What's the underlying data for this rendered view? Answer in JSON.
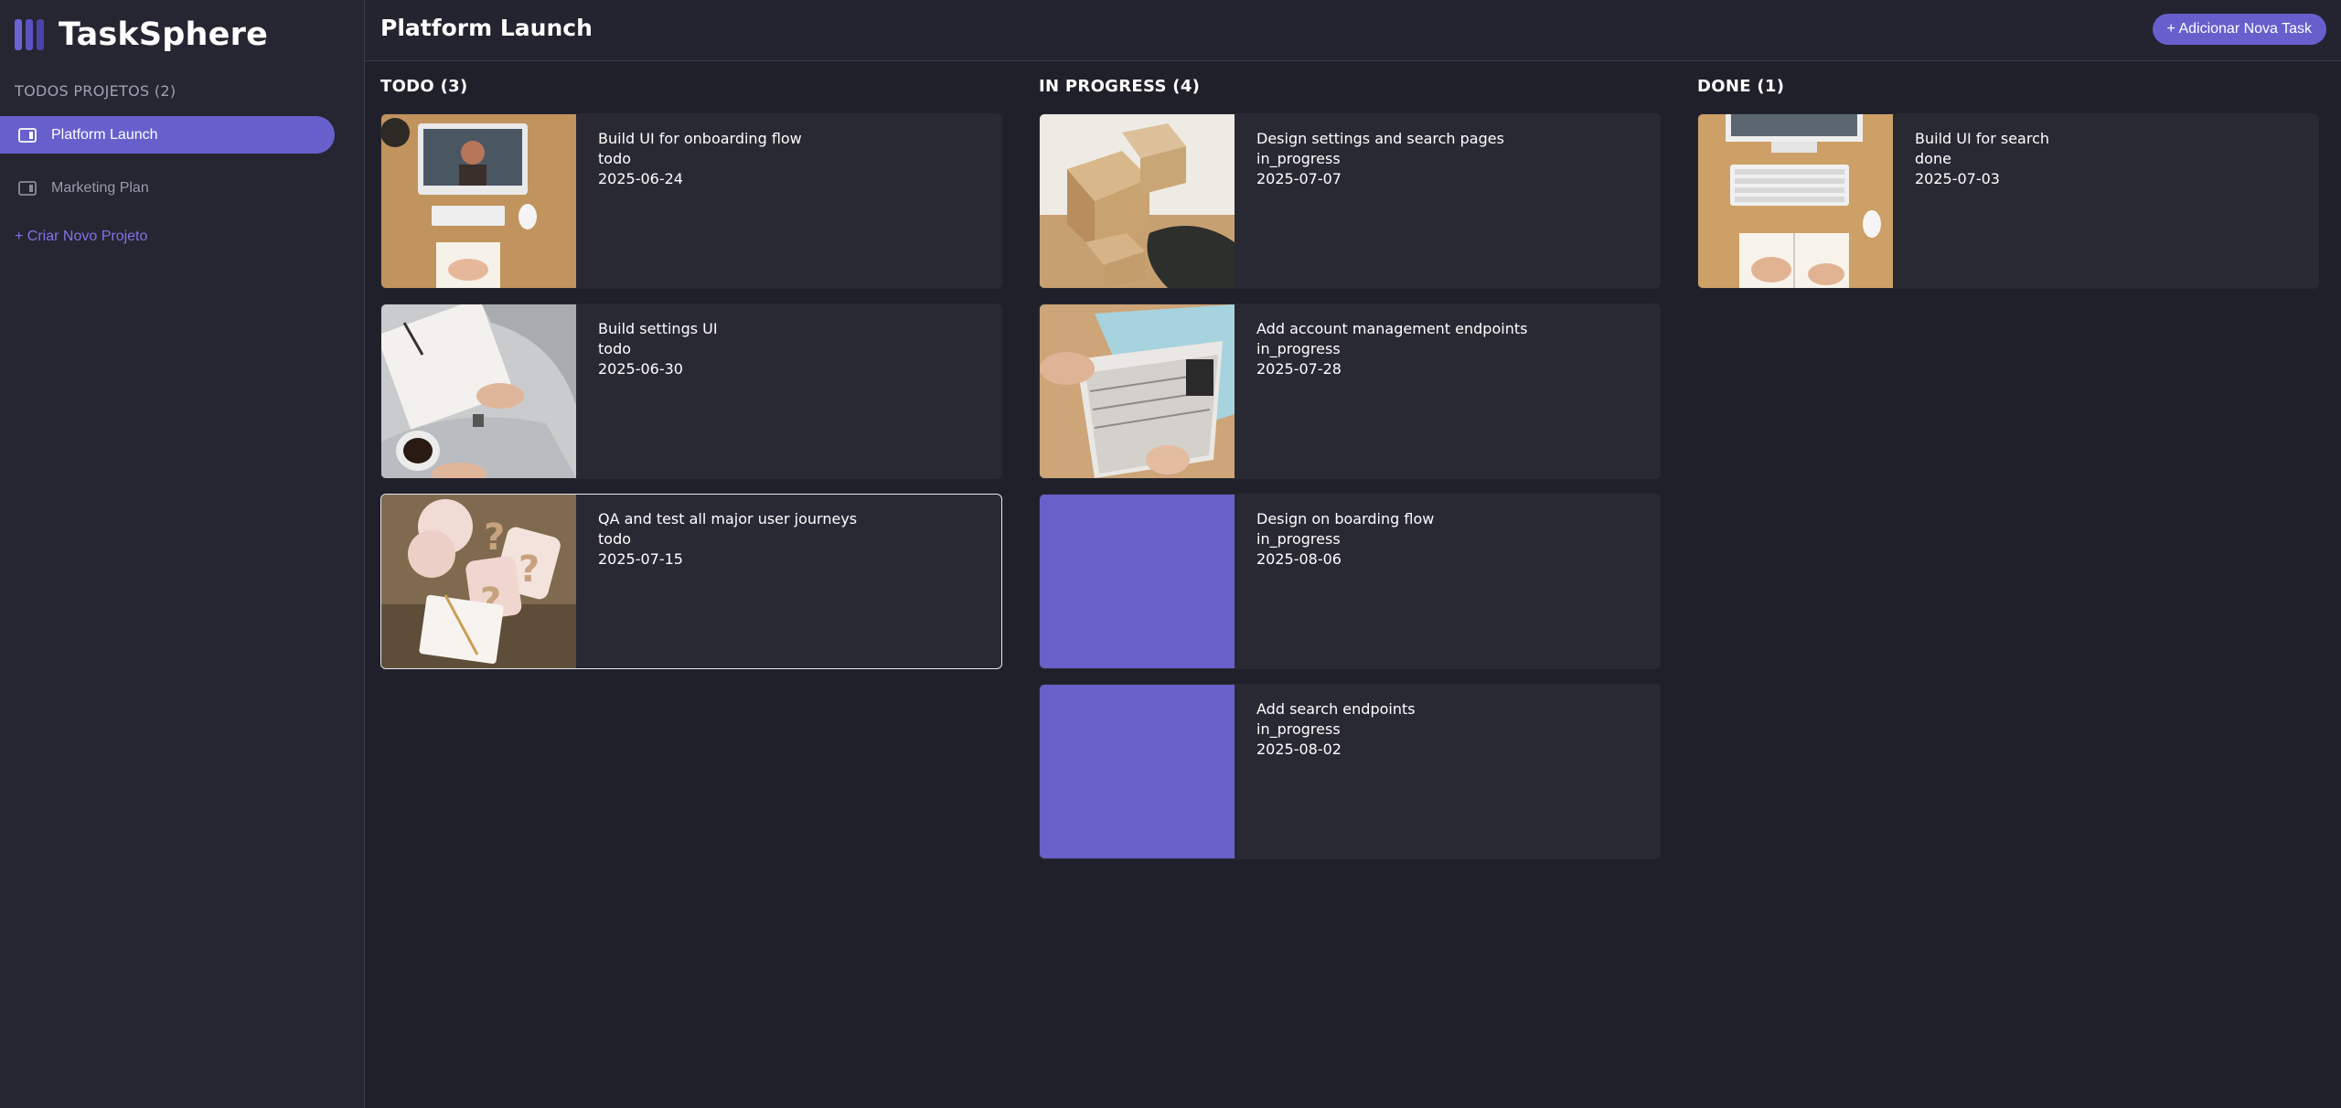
{
  "sidebar": {
    "brand": "TaskSphere",
    "section_label": "TODOS PROJETOS (2)",
    "projects": [
      {
        "label": "Platform Launch",
        "active": true
      },
      {
        "label": "Marketing Plan",
        "active": false
      }
    ],
    "new_project_label": "+ Criar Novo Projeto"
  },
  "header": {
    "title": "Platform Launch",
    "add_task_label": "+ Adicionar Nova Task"
  },
  "columns": [
    {
      "title": "TODO (3)",
      "cards": [
        {
          "title": "Build UI for onboarding flow",
          "status": "todo",
          "date": "2025-06-24",
          "image": "desk-video-call-photo"
        },
        {
          "title": "Build settings UI",
          "status": "todo",
          "date": "2025-06-30",
          "image": "writing-coffee-photo"
        },
        {
          "title": "QA and test all major user journeys",
          "status": "todo",
          "date": "2025-07-15",
          "image": "question-marks-photo"
        }
      ]
    },
    {
      "title": "IN PROGRESS (4)",
      "cards": [
        {
          "title": "Design settings and search pages",
          "status": "in_progress",
          "date": "2025-07-07",
          "image": "cardboard-boxes-photo"
        },
        {
          "title": "Add account management endpoints",
          "status": "in_progress",
          "date": "2025-07-28",
          "image": "file-folder-photo"
        },
        {
          "title": "Design on boarding flow",
          "status": "in_progress",
          "date": "2025-08-06",
          "image": "placeholder"
        },
        {
          "title": "Add search endpoints",
          "status": "in_progress",
          "date": "2025-08-02",
          "image": "placeholder"
        }
      ]
    },
    {
      "title": "DONE (1)",
      "cards": [
        {
          "title": "Build UI for search",
          "status": "done",
          "date": "2025-07-03",
          "image": "keyboard-desk-photo"
        }
      ]
    }
  ],
  "colors": {
    "accent": "#6760cc",
    "background": "#20202a",
    "sidebar": "#262632",
    "card": "#292934"
  }
}
